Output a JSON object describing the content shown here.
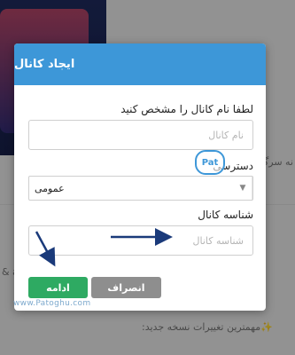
{
  "background": {
    "line1": "نه سرگ",
    "line2": "ap &",
    "line3": "✨مهمترین تغییرات نسخه جدید:"
  },
  "dialog": {
    "title": "ایجاد کانال",
    "name_label": "لطفا نام کانال را مشخص کنید",
    "name_placeholder": "نام کانال",
    "access_label": "دسترسی",
    "access_value": "عمومی",
    "id_label": "شناسه کانال",
    "id_placeholder": "شناسه کانال",
    "continue_label": "ادامه",
    "cancel_label": "انصراف"
  },
  "watermark": {
    "site": "www.Patoghu.com",
    "logo": "Pat"
  },
  "colors": {
    "header": "#3d97d8",
    "continue": "#2eaa62",
    "cancel": "#8e8e8e",
    "arrow": "#1a3a7a"
  }
}
